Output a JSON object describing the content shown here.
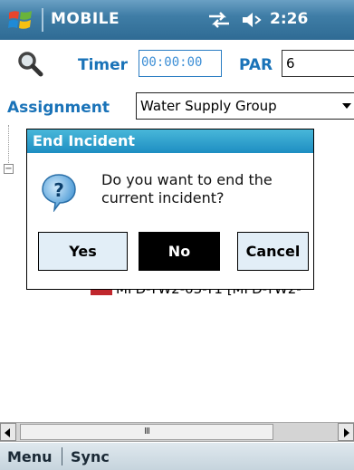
{
  "statusbar": {
    "app_title": "MOBILE",
    "time": "2:26",
    "icons": [
      "windows-logo-icon",
      "signal-icon",
      "volume-icon"
    ]
  },
  "form": {
    "timer_label": "Timer",
    "timer_value": "00:00:00",
    "par_label": "PAR",
    "par_value": "6",
    "assignment_label": "Assignment",
    "assignment_value": "Water Supply Group"
  },
  "tree": {
    "node_text": "MFD-TW2-03-T1 [MFD-TW2-"
  },
  "dialog": {
    "title": "End Incident",
    "message": "Do you want to end the current incident?",
    "buttons": {
      "yes": "Yes",
      "no": "No",
      "cancel": "Cancel"
    }
  },
  "scrollbar": {
    "thumb_grip": "III"
  },
  "softkeys": {
    "menu": "Menu",
    "sync": "Sync"
  },
  "colors": {
    "titlebar": "#2f6b94",
    "dialog_title": "#1e8ec2",
    "label_blue": "#1a73b8",
    "selected_button": "#000000"
  }
}
